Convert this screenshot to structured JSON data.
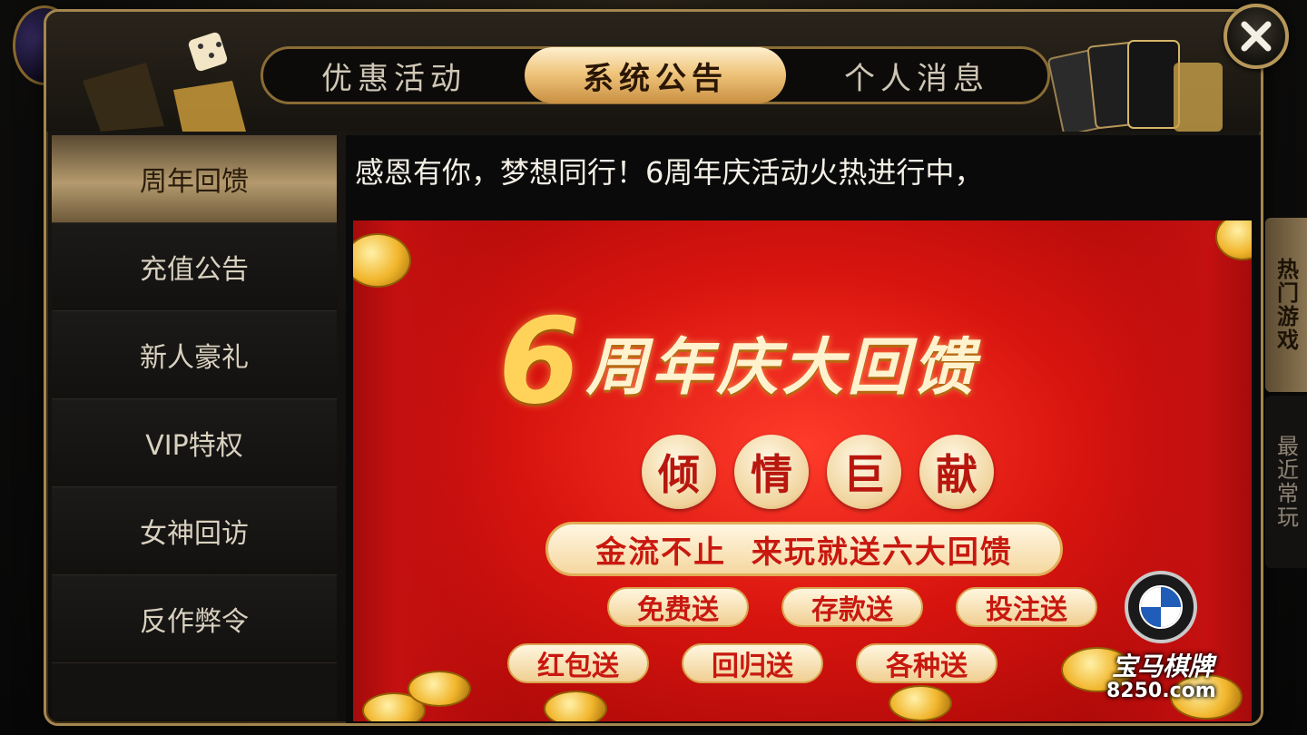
{
  "tabs": [
    {
      "label": "优惠活动",
      "active": false
    },
    {
      "label": "系统公告",
      "active": true
    },
    {
      "label": "个人消息",
      "active": false
    }
  ],
  "close_icon": "close-icon",
  "sidebar": {
    "items": [
      {
        "label": "周年回馈",
        "active": true
      },
      {
        "label": "充值公告",
        "active": false
      },
      {
        "label": "新人豪礼",
        "active": false
      },
      {
        "label": "VIP特权",
        "active": false
      },
      {
        "label": "女神回访",
        "active": false
      },
      {
        "label": "反作弊令",
        "active": false
      }
    ]
  },
  "content": {
    "headline": "感恩有你，梦想同行！6周年庆活动火热进行中，",
    "banner": {
      "number": "6",
      "title": "周年庆大回馈",
      "seals": [
        "倾",
        "情",
        "巨",
        "献"
      ],
      "slogan": "金流不止  来玩就送六大回馈",
      "pills": [
        "免费送",
        "存款送",
        "投注送",
        "红包送",
        "回归送",
        "各种送"
      ],
      "brand_name": "宝马棋牌",
      "brand_url": "8250.com"
    }
  },
  "right_tabs": {
    "hot": "热门游戏",
    "recent": "最近常玩"
  },
  "colors": {
    "accent_gold": "#c99041",
    "banner_red": "#d8140f",
    "frame": "#a58650"
  }
}
